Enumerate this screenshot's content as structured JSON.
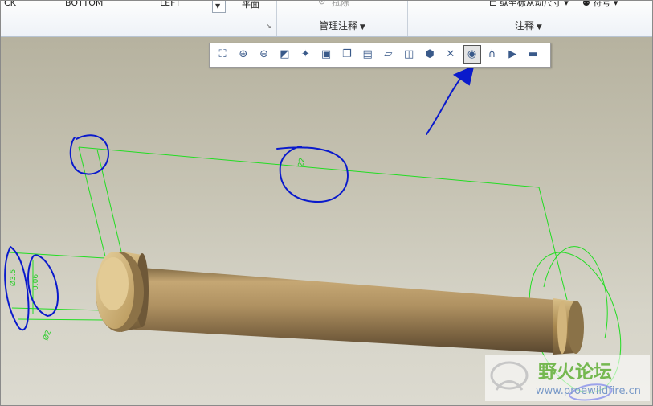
{
  "ribbon": {
    "view_back": "CK",
    "view_bottom": "BOTTOM",
    "view_left": "LEFT",
    "plane_label": "平面",
    "erase_label": "拭除",
    "group_manage_annotations": "管理注释",
    "group_annotations": "注释",
    "driving_dim_label": "纵坐标从动尺寸",
    "symbol_label": "符号",
    "group_arrow": "▾"
  },
  "graphics_toolbar": {
    "buttons": [
      {
        "name": "zoom-refit-icon",
        "glyph": "⛶"
      },
      {
        "name": "zoom-in-icon",
        "glyph": "⊕"
      },
      {
        "name": "zoom-out-icon",
        "glyph": "⊖"
      },
      {
        "name": "repaint-icon",
        "glyph": "◩"
      },
      {
        "name": "spin-center-icon",
        "glyph": "✦"
      },
      {
        "name": "display-style-icon",
        "glyph": "▣"
      },
      {
        "name": "saved-views-icon",
        "glyph": "❐"
      },
      {
        "name": "view-manager-icon",
        "glyph": "▤"
      },
      {
        "name": "datum-display-icon",
        "glyph": "▱"
      },
      {
        "name": "orient-icon",
        "glyph": "◫"
      },
      {
        "name": "perspective-icon",
        "glyph": "⬢"
      },
      {
        "name": "annotation-display-icon",
        "glyph": "✕"
      },
      {
        "name": "annotation-filter-icon",
        "glyph": "◉",
        "selected": true
      },
      {
        "name": "point-display-icon",
        "glyph": "⋔"
      },
      {
        "name": "play-icon",
        "glyph": "▶"
      },
      {
        "name": "annotation-orientation-icon",
        "glyph": "▬"
      }
    ]
  },
  "model": {
    "dimensions": [
      "22",
      "Ø3.5",
      "0.06",
      "Ø2"
    ]
  },
  "watermark": {
    "title": "野火论坛",
    "url": "www.proewildfire.cn"
  },
  "colors": {
    "dimension_green": "#22dd22",
    "annotation_blue": "#0a1acc",
    "shaft_brass": "#b89a5e"
  }
}
